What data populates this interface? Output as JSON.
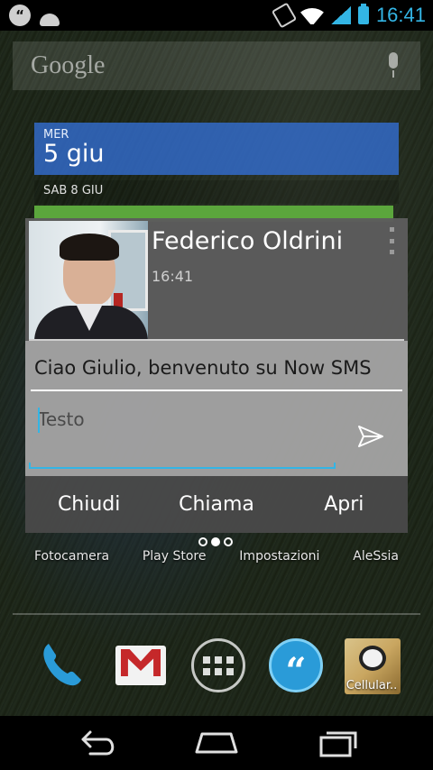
{
  "status_bar": {
    "time": "16:41",
    "left_icons": [
      "now-sms-icon",
      "android-icon"
    ],
    "right_icons": [
      "rotate-icon",
      "wifi-icon",
      "signal-icon",
      "battery-icon"
    ],
    "left_icon_glyph": "“"
  },
  "search_widget": {
    "logo": "Google",
    "icon": "mic-icon"
  },
  "calendar_widget": {
    "day": "MER",
    "date": "5 giu",
    "next_day": "SAB 8 GIU"
  },
  "sms_popup": {
    "contact_name": "Federico Oldrini",
    "time": "16:41",
    "message": "Ciao Giulio, benvenuto su Now SMS",
    "reply_placeholder": "Testo",
    "actions": {
      "close": "Chiudi",
      "call": "Chiama",
      "open": "Apri"
    }
  },
  "home_screen": {
    "page_indicator": {
      "pages": 3,
      "current": 2
    },
    "app_labels": [
      "Fotocamera",
      "Play Store",
      "Impostazioni",
      "AleSsia"
    ],
    "dock": {
      "items": [
        "phone-icon",
        "gmail-icon",
        "app-drawer-icon",
        "now-sms-icon",
        "cellular-icon"
      ],
      "cellular_label": "Cellular..",
      "now_sms_glyph": "“"
    }
  },
  "nav_bar": {
    "buttons": [
      "back-icon",
      "home-icon",
      "recent-apps-icon"
    ]
  },
  "colors": {
    "accent": "#33b5e5",
    "calendar_blue": "#336ed2",
    "popup_header": "#5c5c5c",
    "popup_body": "#a2a2a2",
    "popup_actions": "#484848"
  }
}
